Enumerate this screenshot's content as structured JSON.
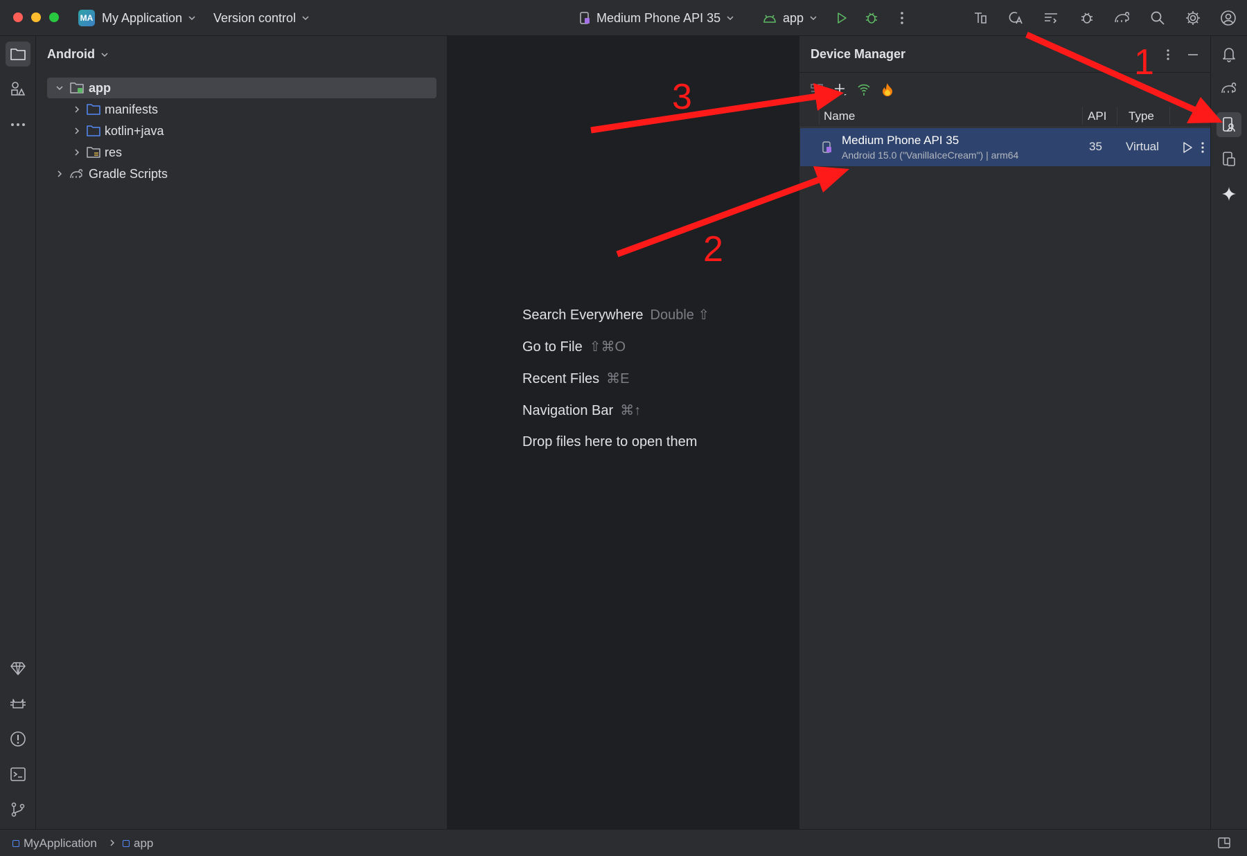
{
  "titlebar": {
    "project_badge": "MA",
    "project_name": "My Application",
    "vcs": "Version control",
    "device": "Medium Phone API 35",
    "run_config": "app"
  },
  "project_panel": {
    "view_mode": "Android",
    "tree": [
      {
        "label": "app"
      },
      {
        "label": "manifests"
      },
      {
        "label": "kotlin+java"
      },
      {
        "label": "res"
      },
      {
        "label": "Gradle Scripts"
      }
    ]
  },
  "editor": {
    "hints": [
      {
        "action": "Search Everywhere",
        "shortcut": "Double ⇧"
      },
      {
        "action": "Go to File",
        "shortcut": "⇧⌘O"
      },
      {
        "action": "Recent Files",
        "shortcut": "⌘E"
      },
      {
        "action": "Navigation Bar",
        "shortcut": "⌘↑"
      },
      {
        "action": "Drop files here to open them",
        "shortcut": ""
      }
    ]
  },
  "device_manager": {
    "title": "Device Manager",
    "columns": {
      "name": "Name",
      "api": "API",
      "type": "Type"
    },
    "devices": [
      {
        "name": "Medium Phone API 35",
        "subtitle": "Android 15.0 (\"VanillaIceCream\") | arm64",
        "api": "35",
        "type": "Virtual"
      }
    ]
  },
  "statusbar": {
    "crumbs": [
      "MyApplication",
      "app"
    ]
  },
  "annotations": [
    "1",
    "2",
    "3"
  ],
  "colors": {
    "accent": "#548af7",
    "selection": "#2e436e",
    "annotation": "#ff1a1a",
    "run_green": "#5fb865"
  }
}
